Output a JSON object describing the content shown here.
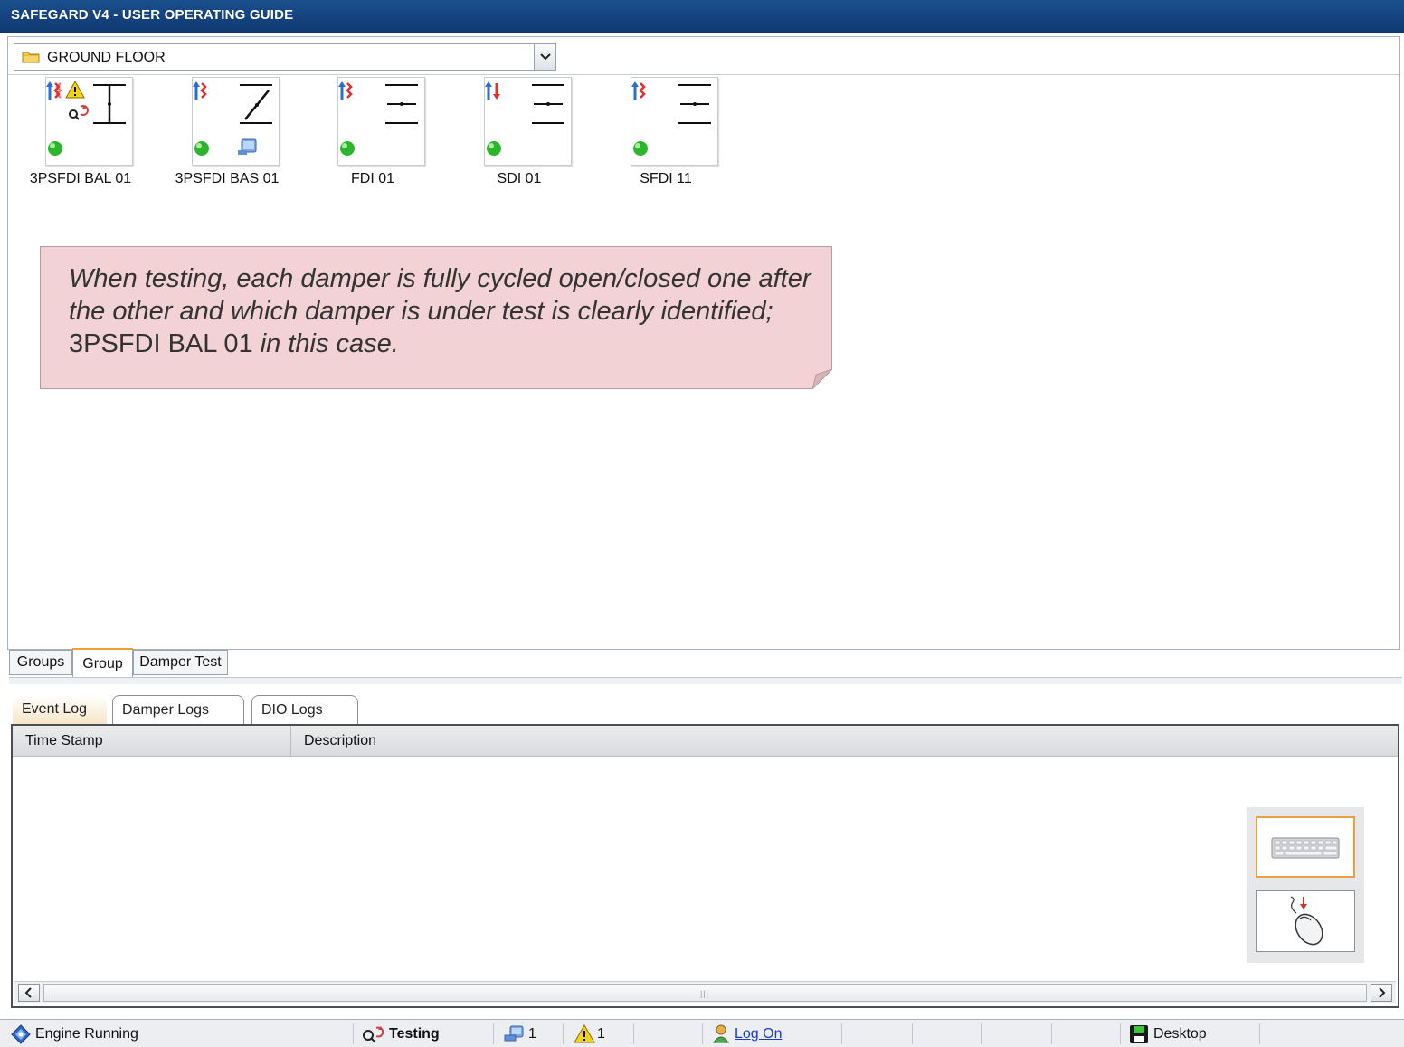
{
  "window": {
    "title": "SAFEGARD V4 - USER OPERATING GUIDE"
  },
  "floor": {
    "selected": "GROUND FLOOR"
  },
  "dampers": [
    {
      "name": "3PSFDI BAL 01",
      "flow": "mixed",
      "warning": true,
      "testing": true,
      "status": "green",
      "blade": "open-vertical"
    },
    {
      "name": "3PSFDI BAS 01",
      "flow": "mixed",
      "warning": false,
      "testing": false,
      "status": "green",
      "blade": "diagonal",
      "bas": true
    },
    {
      "name": "FDI 01",
      "flow": "mixed",
      "warning": false,
      "testing": false,
      "status": "green",
      "blade": "closed"
    },
    {
      "name": "SDI 01",
      "flow": "up-down",
      "warning": false,
      "testing": false,
      "status": "green",
      "blade": "closed"
    },
    {
      "name": "SFDI 11",
      "flow": "mixed",
      "warning": false,
      "testing": false,
      "status": "green",
      "blade": "closed"
    }
  ],
  "note": {
    "part1": "When testing, each damper is fully cycled open/closed one after the other and which damper is under test is clearly identified;",
    "damper": " 3PSFDI BAL 01 ",
    "part2": "in this case."
  },
  "view_tabs": [
    {
      "label": "Groups",
      "active": false
    },
    {
      "label": "Group",
      "active": true
    },
    {
      "label": "Damper Test",
      "active": false
    }
  ],
  "log_tabs": [
    {
      "label": "Event Log",
      "active": true
    },
    {
      "label": "Damper Logs",
      "active": false
    },
    {
      "label": "DIO Logs",
      "active": false
    }
  ],
  "log_table": {
    "columns": [
      "Time Stamp",
      "Description"
    ],
    "rows": []
  },
  "statusbar": {
    "engine": "Engine Running",
    "mode": "Testing",
    "bas_count": "1",
    "warning_count": "1",
    "logon": "Log On",
    "desktop": "Desktop"
  },
  "colors": {
    "title_bar": "#0e3870",
    "note_bg": "#f2d2d5",
    "active_tab_accent": "#f0a030",
    "status_green": "#2db52d",
    "link": "#1a3cc8"
  }
}
